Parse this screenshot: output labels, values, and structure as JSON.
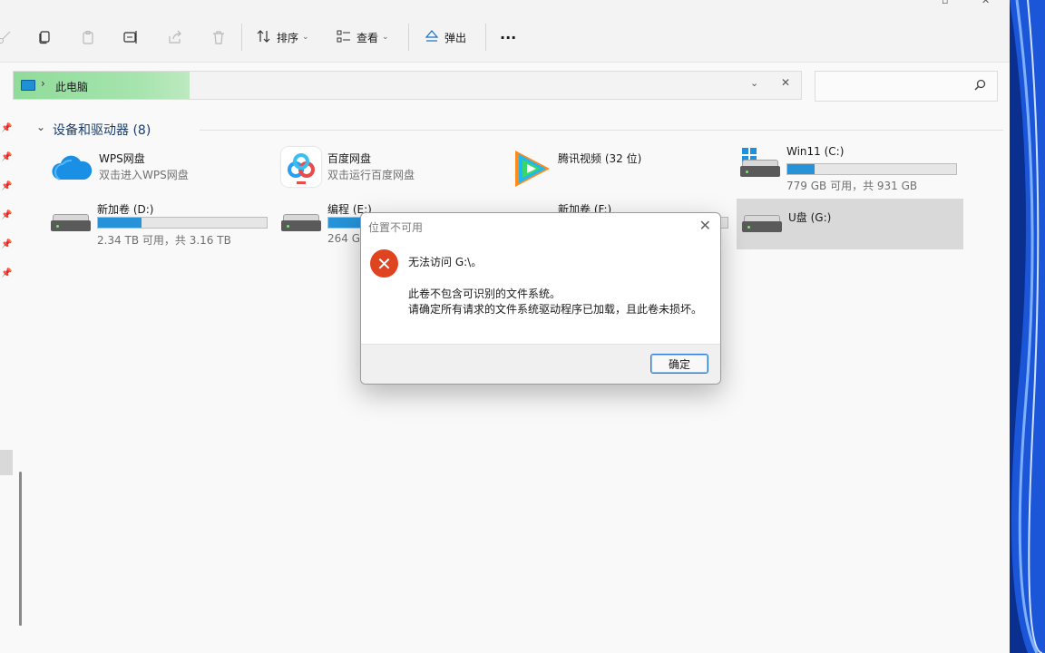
{
  "toolbar": {
    "sort_label": "排序",
    "view_label": "查看",
    "eject_label": "弹出",
    "more_label": "···"
  },
  "address": {
    "path": "此电脑",
    "separator": "›"
  },
  "search": {
    "placeholder": ""
  },
  "section": {
    "title": "设备和驱动器 (8)"
  },
  "items": [
    {
      "name": "WPS网盘",
      "sub": "双击进入WPS网盘"
    },
    {
      "name": "百度网盘",
      "sub": "双击运行百度网盘"
    },
    {
      "name": "腾讯视频 (32 位)"
    },
    {
      "name": "Win11 (C:)",
      "capacity": "779 GB 可用，共 931 GB",
      "used_fraction": 0.16
    },
    {
      "name": "新加卷 (D:)",
      "capacity": "2.34 TB 可用，共 3.16 TB",
      "used_fraction": 0.26
    },
    {
      "name": "编程 (E:)",
      "capacity": "264 G",
      "used_fraction": 0.2
    },
    {
      "name": "新加卷 (F:)"
    },
    {
      "name": "U盘 (G:)"
    }
  ],
  "dialog": {
    "title": "位置不可用",
    "close": "✕",
    "message": "无法访问 G:\\。",
    "detail_line1": "此卷不包含可识别的文件系统。",
    "detail_line2": "请确定所有请求的文件系统驱动程序已加载，且此卷未损坏。",
    "ok_label": "确定"
  },
  "colors": {
    "accent": "#2692d8",
    "error": "#e0431f",
    "address_progress": "#a6e4ad"
  }
}
